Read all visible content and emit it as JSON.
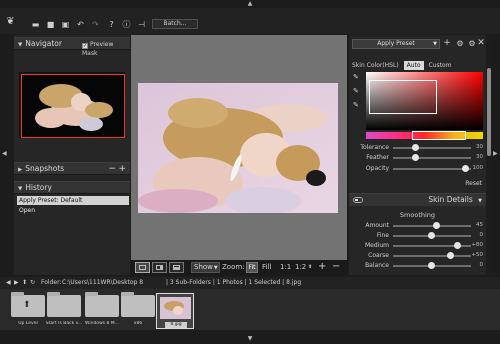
{
  "toolbar": {
    "icons": [
      "app-logo-icon",
      "open-folder-icon",
      "save-icon",
      "save-as-icon",
      "undo-icon",
      "redo-icon",
      "help-icon",
      "info-icon",
      "plugin-icon"
    ],
    "batch_label": "Batch..."
  },
  "navigator": {
    "title": "Navigator",
    "preview_mask_label": "Preview Mask"
  },
  "snapshots": {
    "title": "Snapshots",
    "minus": "−",
    "plus": "+"
  },
  "history": {
    "title": "History",
    "items": [
      "Apply Preset: Default",
      "Open"
    ]
  },
  "viewbar": {
    "show_label": "Show",
    "zoom_label": "Zoom:",
    "fit": "Fit",
    "fill": "Fill",
    "one_to_one": "1:1",
    "one_to_two": "1:2"
  },
  "right": {
    "preset_label": "Apply Preset",
    "skin_color_label": "Skin Color(HSL)",
    "auto_label": "Auto",
    "custom_label": "Custom",
    "tolerance": {
      "label": "Tolerance",
      "value": "30"
    },
    "feather": {
      "label": "Feather",
      "value": "30"
    },
    "opacity": {
      "label": "Opacity",
      "value": "100"
    },
    "reset_label": "Reset",
    "skin_details_title": "Skin Details",
    "smoothing_label": "Smoothing",
    "amount": {
      "label": "Amount",
      "value": "45"
    },
    "fine": {
      "label": "Fine",
      "value": "0"
    },
    "medium": {
      "label": "Medium",
      "value": "+80"
    },
    "coarse": {
      "label": "Coarse",
      "value": "+50"
    },
    "balance": {
      "label": "Balance",
      "value": "0"
    }
  },
  "path_bar": {
    "folder_label": "Folder:",
    "path": "C:\\Users\\111WR\\Desktop 8",
    "summary": "| 3 Sub-Folders | 1 Photos | 1 Selected | 8.jpg"
  },
  "thumbnails": [
    {
      "label": "Up Level",
      "kind": "up"
    },
    {
      "label": "Start Is Back v...",
      "kind": "folder"
    },
    {
      "label": "Windows 8 M...",
      "kind": "folder"
    },
    {
      "label": "x86",
      "kind": "folder"
    },
    {
      "label": "8.jpg",
      "kind": "image"
    }
  ],
  "colors": {
    "panel_bg": "#262626",
    "canvas_bg": "#737373",
    "picker_red": "#ff0000"
  }
}
